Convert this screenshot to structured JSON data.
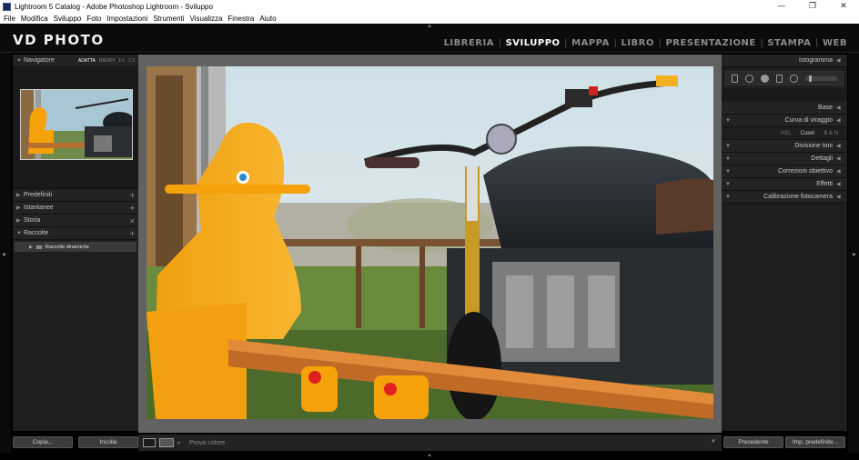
{
  "window": {
    "title": "Lightroom 5 Catalog - Adobe Photoshop Lightroom - Sviluppo",
    "minimize": "—",
    "maximize": "❐",
    "close": "✕"
  },
  "menu": [
    "File",
    "Modifica",
    "Sviluppo",
    "Foto",
    "Impostazioni",
    "Strumenti",
    "Visualizza",
    "Finestra",
    "Aiuto"
  ],
  "identity_plate": "VD PHOTO",
  "modules": [
    {
      "label": "LIBRERIA",
      "active": false
    },
    {
      "label": "SVILUPPO",
      "active": true
    },
    {
      "label": "MAPPA",
      "active": false
    },
    {
      "label": "LIBRO",
      "active": false
    },
    {
      "label": "PRESENTAZIONE",
      "active": false
    },
    {
      "label": "STAMPA",
      "active": false
    },
    {
      "label": "WEB",
      "active": false
    }
  ],
  "left_panel": {
    "navigator": {
      "title": "Navigatore",
      "options": [
        "ADATTA",
        "RIEMPI",
        "1:1",
        "1:2"
      ],
      "selected": "ADATTA"
    },
    "sections": [
      {
        "title": "Predefiniti",
        "action": "+"
      },
      {
        "title": "Istantanee",
        "action": "+"
      },
      {
        "title": "Storia",
        "action": "×"
      },
      {
        "title": "Raccolte",
        "action": "+"
      }
    ],
    "collection": "Raccolte dinamiche",
    "buttons": {
      "copy": "Copia...",
      "paste": "Incolla"
    }
  },
  "right_panel": {
    "histogram_title": "Istogramma",
    "sections": [
      "Base",
      "Curva di viraggio",
      "Divisione toni",
      "Dettagli",
      "Correzioni obiettivo",
      "Effetti",
      "Calibrazione fotocamera"
    ],
    "hsl_tabs": [
      "HSL",
      "Colori",
      "B & N"
    ],
    "hsl_selected": "Colori",
    "buttons": {
      "previous": "Precedente",
      "reset": "Imp. predefinite..."
    }
  },
  "toolbar": {
    "soft_proof": "Prova colore"
  },
  "colors": {
    "accent_orange": "#f5a10a",
    "panel_bg": "#1e1e1e",
    "center_bg": "#626262"
  }
}
